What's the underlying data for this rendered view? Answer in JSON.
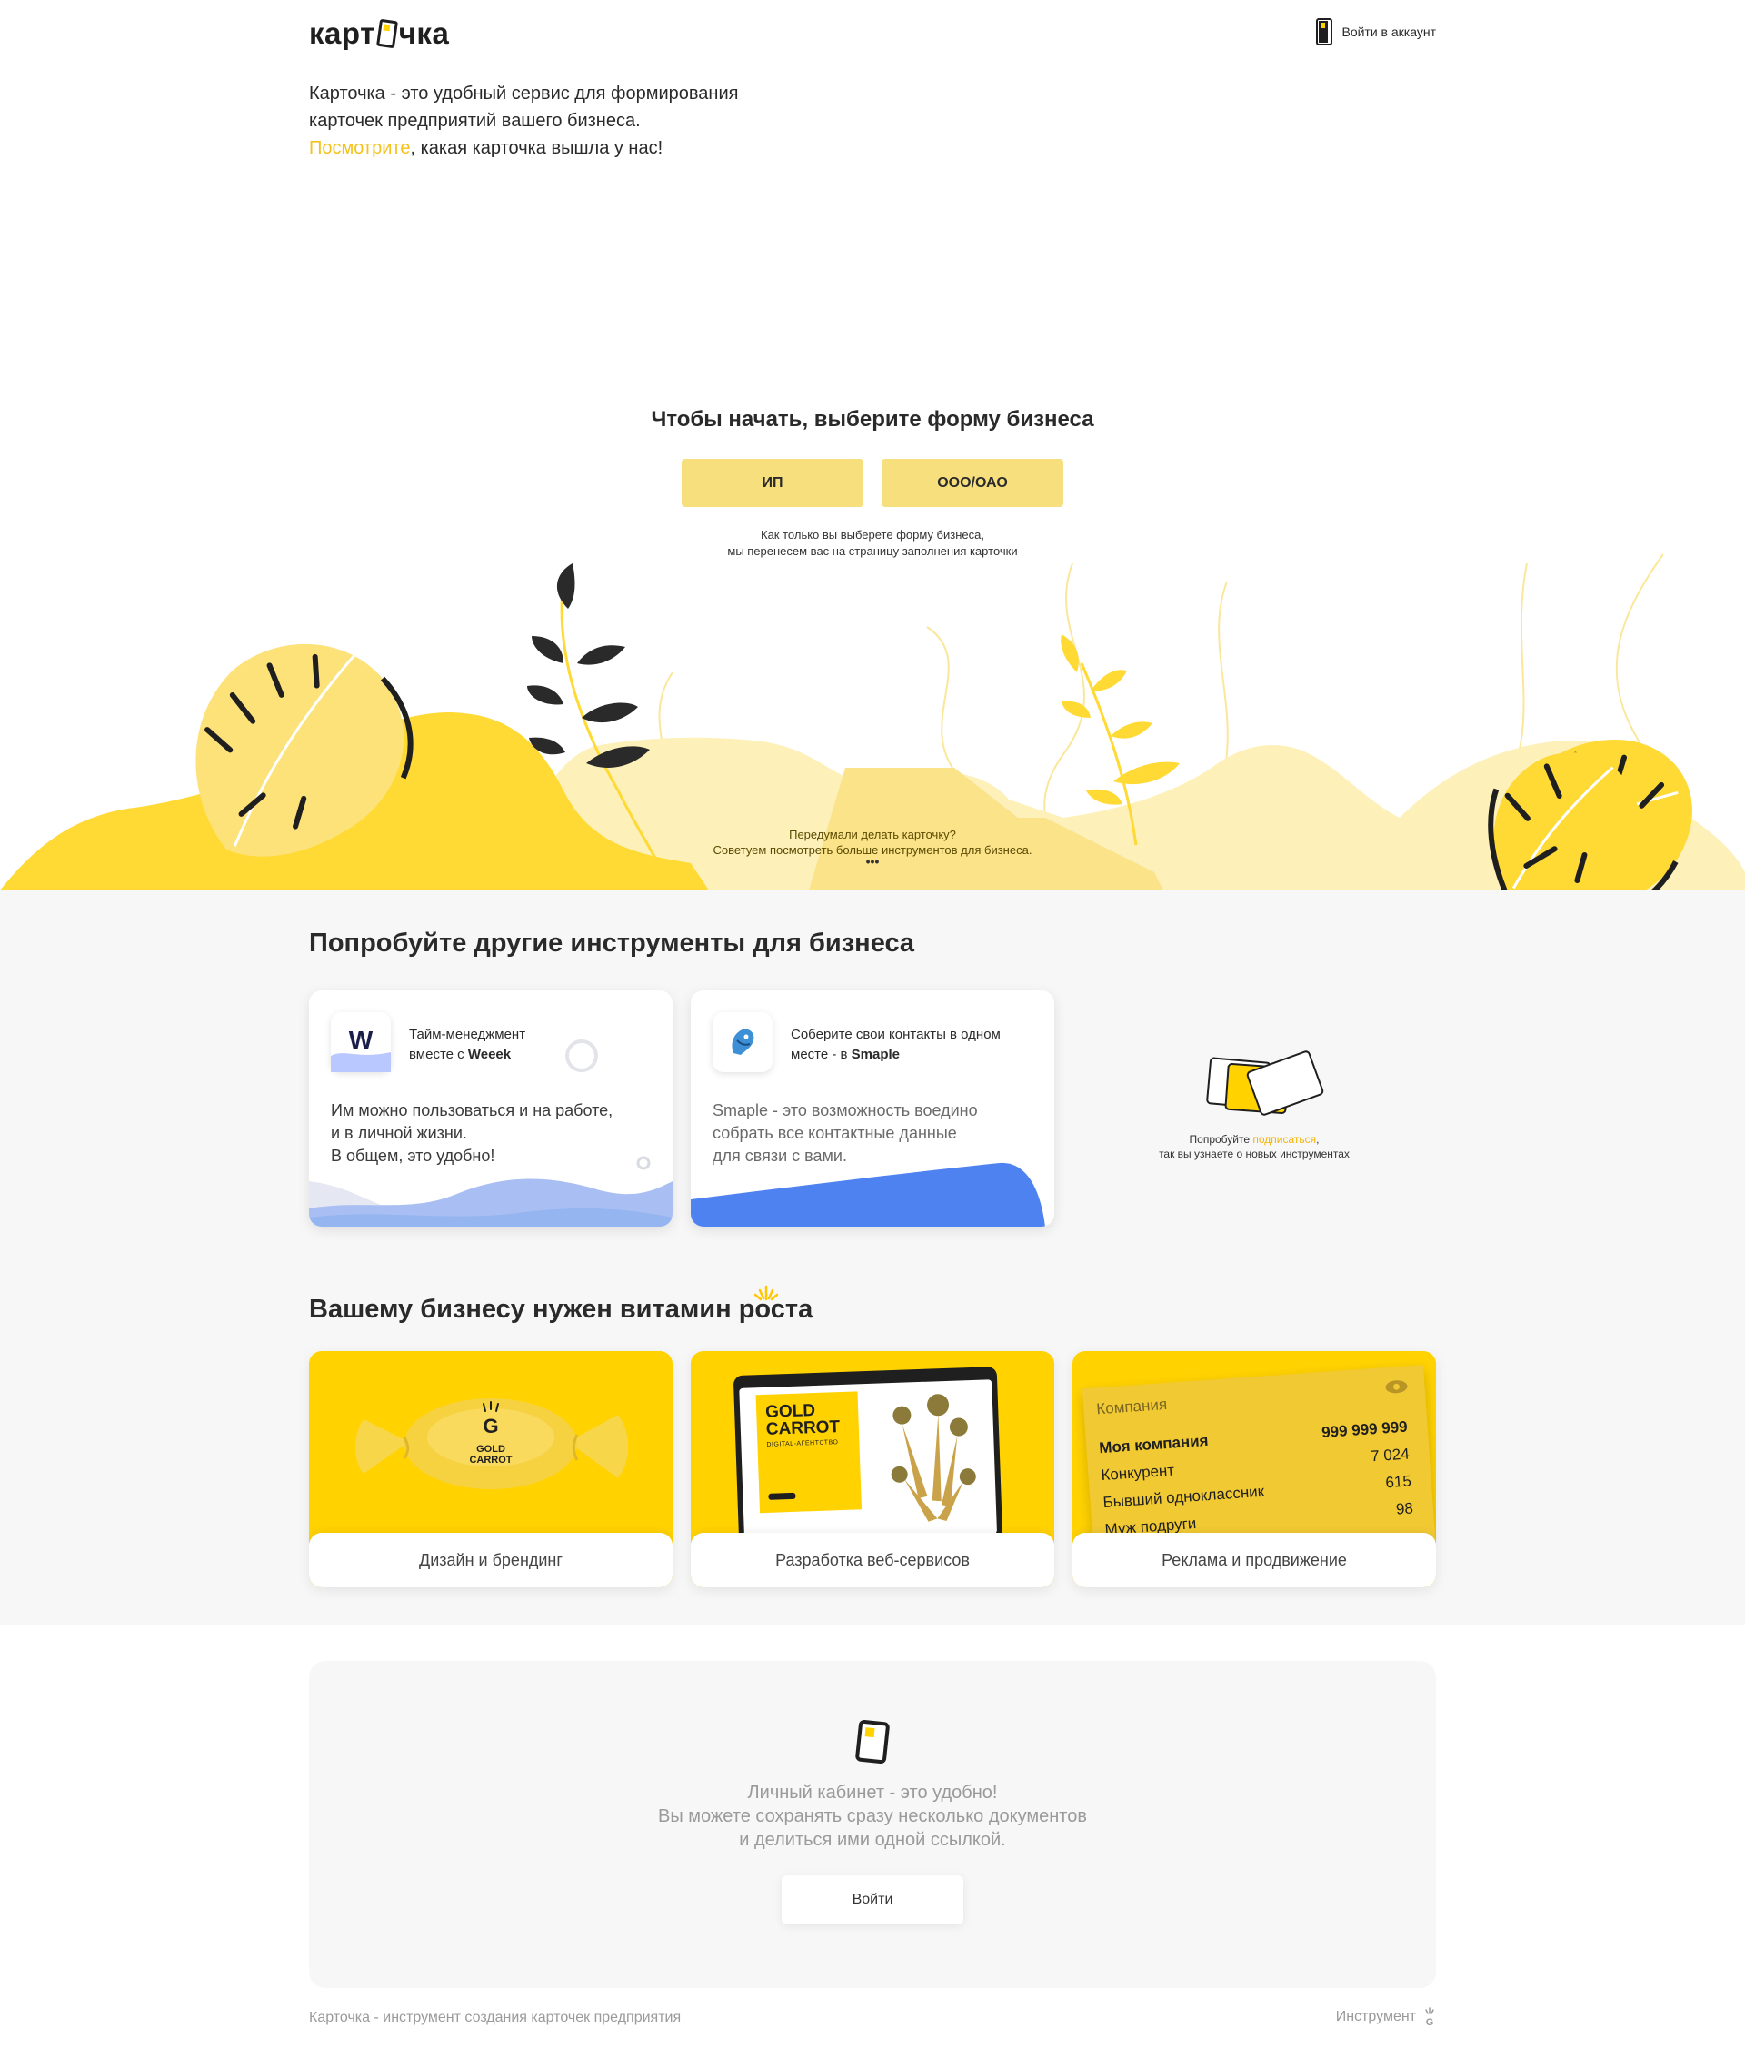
{
  "header": {
    "logo_left": "карт",
    "logo_right": "чка",
    "login_label": "Войти в аккаунт"
  },
  "intro": {
    "line1": "Карточка - это удобный сервис для формирования",
    "line2": "карточек предприятий вашего бизнеса.",
    "link": "Посмотрите",
    "line3_rest": ", какая карточка вышла у нас!"
  },
  "choose": {
    "title": "Чтобы начать, выберите форму бизнеса",
    "btn_ip": "ИП",
    "btn_ooo": "ООО/ОАО",
    "note1": "Как только вы выберете  форму бизнеса,",
    "note2": "мы перенесем вас на страницу заполнения карточки"
  },
  "changed_mind": {
    "line1": "Передумали делать карточку?",
    "line2": "Советуем посмотреть больше инструментов для бизнеса.",
    "dots": "•••"
  },
  "tools": {
    "title": "Попробуйте другие инструменты для бизнеса",
    "weeek": {
      "head1": "Тайм-менеджмент",
      "head2": "вместе с ",
      "head_brand": "Weeek",
      "body1": "Им можно пользоваться и на работе,",
      "body2": "и в личной жизни.",
      "body3": "В общем, это удобно!"
    },
    "smaple": {
      "head1": "Соберите свои контакты в одном",
      "head2": "месте - в ",
      "head_brand": "Smaple",
      "body1": "Smaple - это возможность воедино",
      "body2": "собрать все контактные данные",
      "body3": "для связи с вами."
    },
    "subscribe": {
      "pre": "Попробуйте ",
      "link": "подписаться",
      "post": ",",
      "line2": "так вы узнаете о новых инструментах"
    }
  },
  "vitamin": {
    "title": "Вашему бизнесу нужен витамин роста",
    "cards": [
      {
        "label": "Дизайн и брендинг",
        "brand1": "GOLD",
        "brand2": "CARROT"
      },
      {
        "label": "Разработка веб-сервисов",
        "brand1": "GOLD",
        "brand2": "CARROT",
        "sub": "DIGITAL-АГЕНТСТВО"
      },
      {
        "label": "Реклама и продвижение"
      }
    ],
    "ad_table": {
      "header": "Компания",
      "rows": [
        {
          "name": "Моя компания",
          "value": "999 999 999"
        },
        {
          "name": "Конкурент",
          "value": "7 024"
        },
        {
          "name": "Бывший одноклассник",
          "value": "615"
        },
        {
          "name": "Муж подруги",
          "value": "98"
        }
      ]
    }
  },
  "account": {
    "line1": "Личный кабинет - это удобно!",
    "line2": "Вы можете сохранять сразу несколько документов",
    "line3": "и делиться ими одной ссылкой.",
    "button": "Войти"
  },
  "footer": {
    "left": "Карточка - инструмент создания карточек предприятия",
    "right": "Инструмент"
  },
  "colors": {
    "accent": "#ffd200",
    "button_yellow": "#f7df7d",
    "link_yellow": "#f4c21a",
    "section_gray": "#f7f7f7"
  }
}
